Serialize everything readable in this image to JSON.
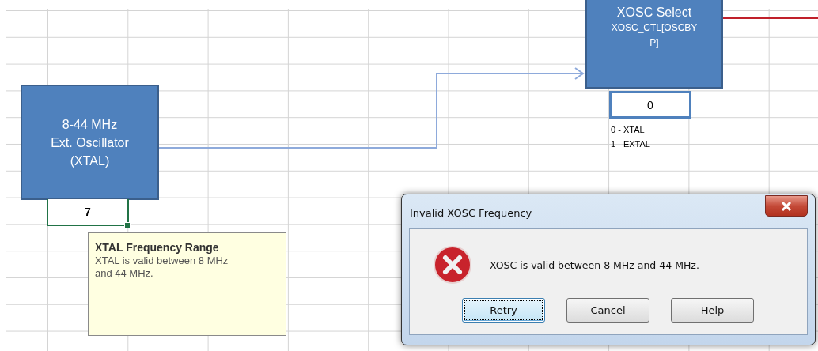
{
  "oscillator_block": {
    "lines": [
      "8-44 MHz",
      "Ext. Oscillator",
      "(XTAL)"
    ]
  },
  "frequency_cell": {
    "value": "7",
    "selected": true
  },
  "comment": {
    "title": "XTAL Frequency Range",
    "text": "XTAL is valid between 8 MHz and 44 MHz."
  },
  "select_block": {
    "title": "XOSC Select",
    "lines": [
      "XOSC_CTL[OSCBY",
      "P]"
    ]
  },
  "select_cell": {
    "value": "0"
  },
  "select_legend": [
    "0 - XTAL",
    "1 - EXTAL"
  ],
  "dialog": {
    "title": "Invalid XOSC Frequency",
    "message": "XOSC is valid between 8 MHz and 44 MHz.",
    "buttons": [
      {
        "label": "Retry",
        "mnemonic": true,
        "focused": true
      },
      {
        "label": "Cancel",
        "mnemonic": false,
        "focused": false
      },
      {
        "label": "Help",
        "mnemonic": true,
        "focused": false
      }
    ]
  }
}
